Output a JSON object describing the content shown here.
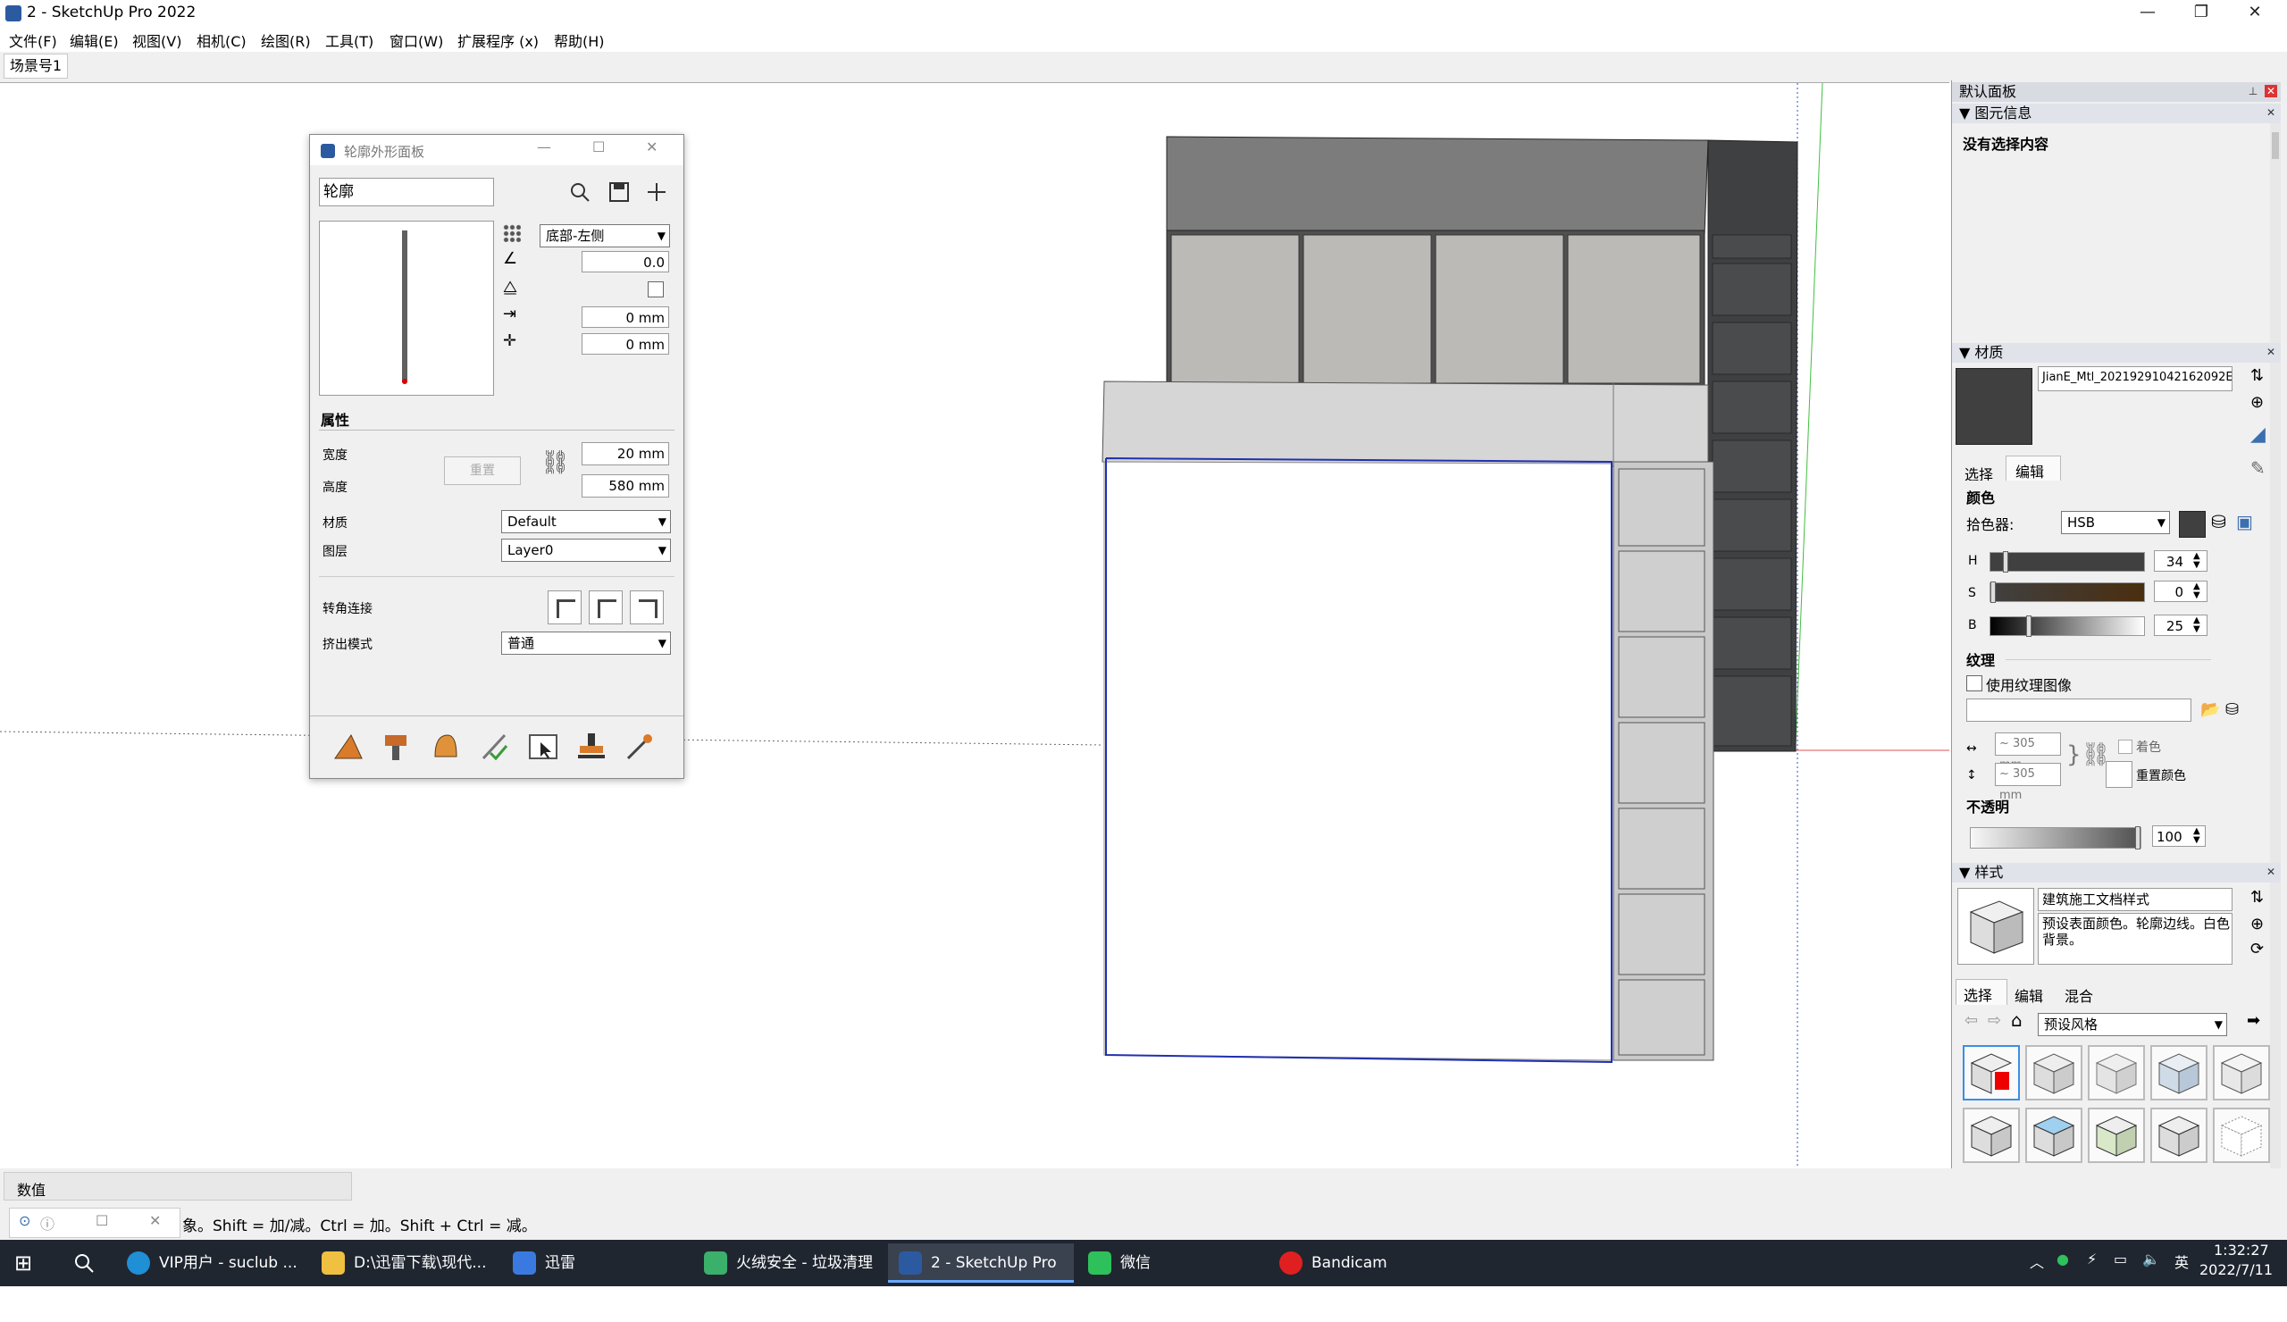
{
  "window": {
    "title": "2 - SketchUp Pro 2022"
  },
  "menu": [
    "文件(F)",
    "编辑(E)",
    "视图(V)",
    "相机(C)",
    "绘图(R)",
    "工具(T)",
    "窗口(W)",
    "扩展程序 (x)",
    "帮助(H)"
  ],
  "scene_tab": "场景号1",
  "profile_panel": {
    "title": "轮廓外形面板",
    "name_value": "轮廓",
    "alignment": "底部-左侧",
    "angle": "0.0",
    "offset_x": "0 mm",
    "offset_y": "0 mm",
    "section_title": "属性",
    "width_label": "宽度",
    "width_value": "20 mm",
    "height_label": "高度",
    "height_value": "580 mm",
    "reset_button": "重置",
    "material_label": "材质",
    "material_value": "Default",
    "layer_label": "图层",
    "layer_value": "Layer0",
    "corner_label": "转角连接",
    "extrude_label": "挤出模式",
    "extrude_value": "普通"
  },
  "tray": {
    "title": "默认面板",
    "entity_info": {
      "header": "图元信息",
      "empty": "没有选择内容"
    },
    "materials": {
      "header": "材质",
      "name": "JianE_Mtl_20219291042162092E",
      "tab_select": "选择",
      "tab_edit": "编辑",
      "color_title": "颜色",
      "picker_label": "拾色器:",
      "picker_value": "HSB",
      "h_label": "H",
      "h_value": "34",
      "s_label": "S",
      "s_value": "0",
      "b_label": "B",
      "b_value": "25",
      "texture_title": "纹理",
      "use_texture": "使用纹理图像",
      "tex_w": "~ 305 mm",
      "tex_h": "~ 305 mm",
      "colorize": "着色",
      "reset_color": "重置颜色",
      "opacity_title": "不透明",
      "opacity_value": "100",
      "swatch_color": "#404040"
    },
    "styles": {
      "header": "样式",
      "name": "建筑施工文档样式",
      "description": "预设表面颜色。轮廓边线。白色背景。",
      "tab_select": "选择",
      "tab_edit": "编辑",
      "tab_mix": "混合",
      "collection": "预设风格"
    }
  },
  "status": {
    "measure_label": "数值",
    "hint": "象。Shift = 加/减。Ctrl = 加。Shift + Ctrl = 减。"
  },
  "taskbar": {
    "items": [
      "VIP用户 - suclub ...",
      "D:\\迅雷下载\\现代...",
      "迅雷",
      "火绒安全 - 垃圾清理",
      "2 - SketchUp Pro ...",
      "微信",
      "Bandicam"
    ],
    "ime": "英",
    "time": "1:32:27",
    "date": "2022/7/11"
  }
}
